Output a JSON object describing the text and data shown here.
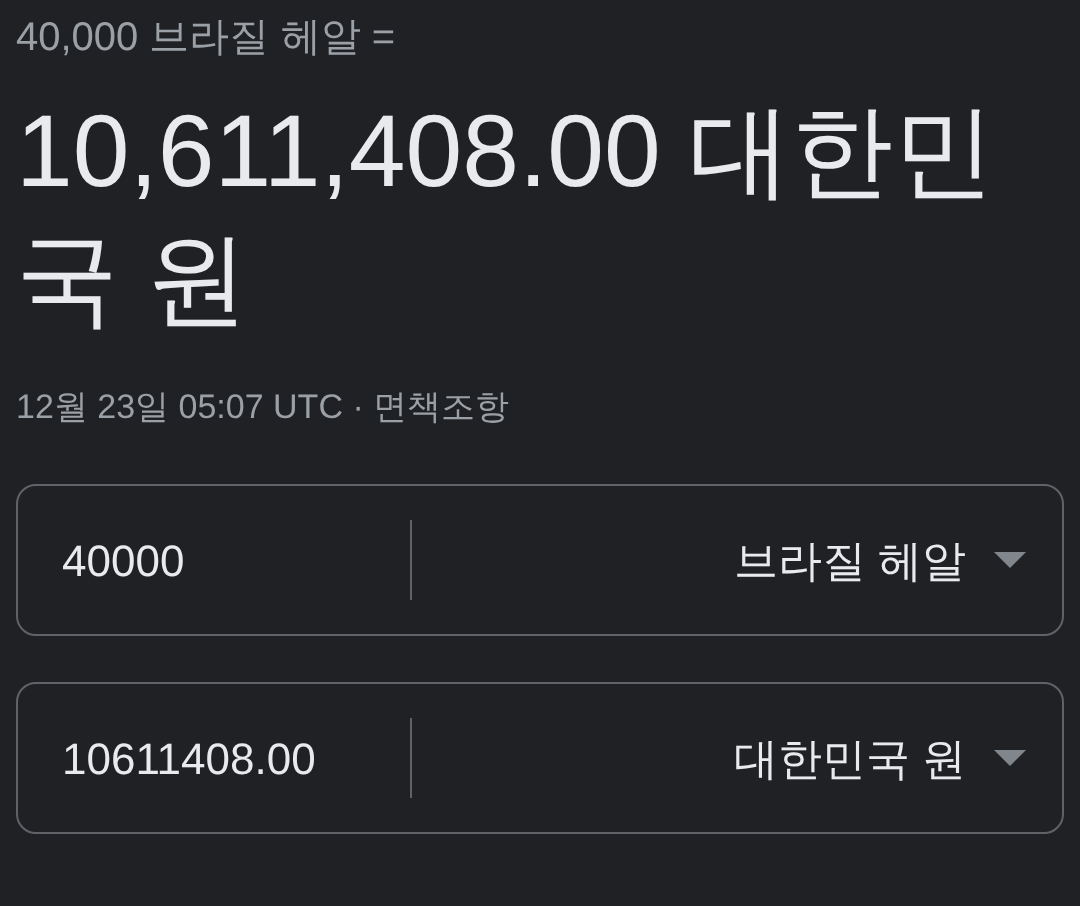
{
  "source_line": "40,000 브라질 헤알 =",
  "result": "10,611,408.00 대한민국 원",
  "timestamp": "12월 23일 05:07 UTC · ",
  "disclaimer": "면책조항",
  "converters": [
    {
      "value": "40000",
      "currency": "브라질 헤알"
    },
    {
      "value": "10611408.00",
      "currency": "대한민국 원"
    }
  ]
}
